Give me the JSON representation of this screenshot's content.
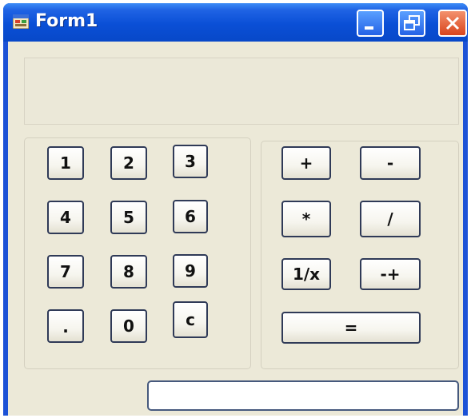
{
  "window": {
    "title": "Form1",
    "icons": {
      "app": "form-app-icon",
      "minimize": "minimize-icon",
      "maximize": "maximize-icon",
      "close": "close-icon"
    }
  },
  "display": {
    "value": ""
  },
  "digits": {
    "one": "1",
    "two": "2",
    "three": "3",
    "four": "4",
    "five": "5",
    "six": "6",
    "seven": "7",
    "eight": "8",
    "nine": "9",
    "dot": ".",
    "zero": "0",
    "clear": "c"
  },
  "operators": {
    "plus": "+",
    "minus": "-",
    "multiply": "*",
    "divide": "/",
    "reciprocal": "1/x",
    "negate": "-+",
    "equals": "="
  },
  "result": {
    "value": ""
  }
}
